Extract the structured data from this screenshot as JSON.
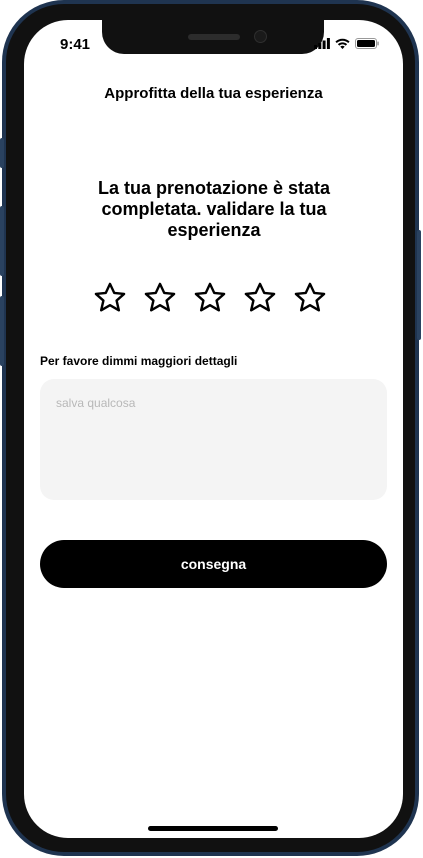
{
  "status_bar": {
    "time": "9:41",
    "icons": [
      "signal-icon",
      "wifi-icon",
      "battery-icon"
    ]
  },
  "header": {
    "title": "Approfitta della tua esperienza"
  },
  "main": {
    "headline": "La tua prenotazione è stata completata. validare la tua esperienza",
    "rating": {
      "max": 5,
      "value": 0,
      "icon": "star-outline-icon"
    },
    "details_label": "Per favore dimmi maggiori dettagli",
    "details_input": {
      "value": "",
      "placeholder": "salva qualcosa"
    },
    "submit_label": "consegna"
  },
  "colors": {
    "frame": "#1f3450",
    "background": "#ffffff",
    "input_bg": "#f4f4f4",
    "button_bg": "#000000",
    "button_text": "#ffffff",
    "placeholder": "#b8b8b8"
  }
}
